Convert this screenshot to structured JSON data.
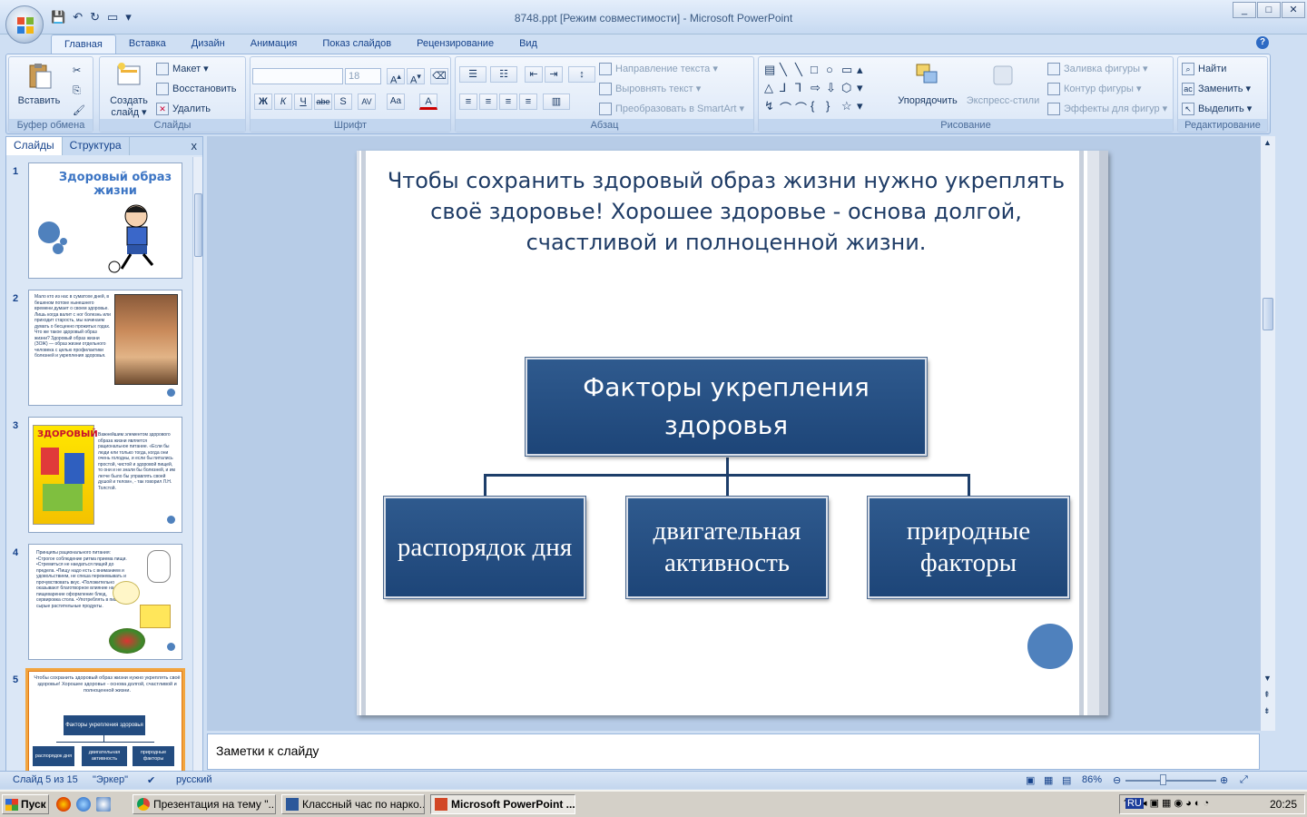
{
  "window": {
    "title": "8748.ppt [Режим совместимости] - Microsoft PowerPoint",
    "controls": [
      "_",
      "□",
      "✕"
    ]
  },
  "qat": {
    "customize": "▾"
  },
  "tabs": [
    "Главная",
    "Вставка",
    "Дизайн",
    "Анимация",
    "Показ слайдов",
    "Рецензирование",
    "Вид"
  ],
  "ribbon": {
    "clipboard": {
      "label": "Буфер обмена",
      "paste": "Вставить"
    },
    "slides": {
      "label": "Слайды",
      "new_slide_line1": "Создать",
      "new_slide_line2": "слайд ▾",
      "layout": "Макет ▾",
      "reset": "Восстановить",
      "delete": "Удалить"
    },
    "font": {
      "label": "Шрифт",
      "font_name": "",
      "font_size": "18",
      "bold": "Ж",
      "italic": "К",
      "underline": "Ч",
      "strike": "abe",
      "shadow": "S",
      "spacing": "AV",
      "case": "Aa",
      "color": "A"
    },
    "paragraph": {
      "label": "Абзац",
      "text_direction": "Направление текста ▾",
      "align_text": "Выровнять текст ▾",
      "smartart": "Преобразовать в SmartArt ▾"
    },
    "drawing": {
      "label": "Рисование",
      "arrange": "Упорядочить",
      "quick_styles": "Экспресс-стили",
      "fill": "Заливка фигуры ▾",
      "outline": "Контур фигуры ▾",
      "effects": "Эффекты для фигур ▾"
    },
    "editing": {
      "label": "Редактирование",
      "find": "Найти",
      "replace": "Заменить ▾",
      "select": "Выделить ▾"
    }
  },
  "panel": {
    "tab_slides": "Слайды",
    "tab_outline": "Структура",
    "close": "x",
    "thumbs": [
      {
        "num": "1",
        "title": "Здоровый образ жизни"
      },
      {
        "num": "2",
        "text": "Мало кто из нас в суматохе дней, в бешеном потоке нынешнего времени думает о своем здоровье. Лишь когда валит с ног болезнь или приходит старость, мы начинаем думать о бесценно прожитых годах. Что же такое здоровый образ жизни? Здоровый образ жизни (ЗОЖ) — образ жизни отдельного человека с целью профилактики болезней и укрепления здоровья."
      },
      {
        "num": "3",
        "text": "Важнейшим элементом здорового образа жизни является рациональное питание. «Если бы люди ели только тогда, когда они очень голодны, и если бы питались простой, чистой и здоровой пищей, то они и не знали бы болезней, и им легче было бы управлять своей душой и телом», - так говорил Л.Н. Толстой."
      },
      {
        "num": "4",
        "text": "Принципы рационального питания: •Строгое соблюдение ритма приема пищи. •Стремиться не наедаться пищей до предела. •Пищу надо есть с вниманием и удовольствием, не спеша пережевывать и прочувствовать вкус. •Положительно оказывают благотворное влияние на пищеварение оформление блюд, сервировка стола. •Употреблять в пищу сырые растительные продукты."
      },
      {
        "num": "5",
        "text": "Чтобы сохранить здоровый образ жизни нужно укреплять своё здоровье! Хорошее здоровье - основа долгой, счастливой и полноценной жизни.",
        "top": "Факторы укрепления здоровья",
        "c1": "распорядок дня",
        "c2": "двигательная активность",
        "c3": "природные факторы"
      }
    ]
  },
  "slide": {
    "title": "Чтобы сохранить здоровый образ жизни нужно укреплять своё здоровье! Хорошее здоровье - основа долгой, счастливой и  полноценной жизни.",
    "top_box": "Факторы укрепления здоровья",
    "child1": "распорядок дня",
    "child2": "двигательная активность",
    "child3": "природные факторы"
  },
  "notes": {
    "placeholder": "Заметки к слайду"
  },
  "status": {
    "slide": "Слайд 5 из 15",
    "theme": "\"Эркер\"",
    "language": "русский",
    "zoom": "86%"
  },
  "taskbar": {
    "start": "Пуск",
    "items": [
      {
        "label": "Презентация на тему \"..."
      },
      {
        "label": "Классный час по нарко..."
      },
      {
        "label": "Microsoft PowerPoint ..."
      }
    ],
    "lang": "RU",
    "clock": "20:25"
  }
}
